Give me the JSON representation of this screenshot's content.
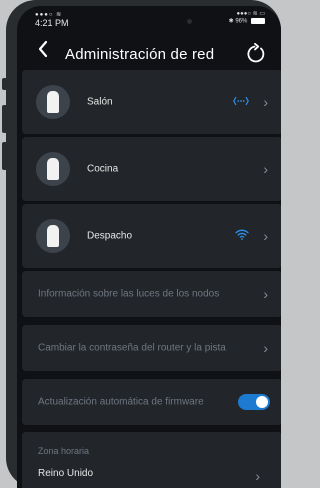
{
  "status_bar": {
    "time": "4:21 PM",
    "signal": "●●●○",
    "right_top": "●●●○",
    "battery": "96%"
  },
  "header": {
    "back_icon": "chevron-left-icon",
    "title": "Administración de red",
    "refresh_icon": "refresh-icon"
  },
  "nodes": [
    {
      "name": "Salón",
      "status_icon": "ethernet-dots-icon",
      "status_color": "#2f8fe8"
    },
    {
      "name": "Cocina",
      "status_icon": "",
      "status_color": ""
    },
    {
      "name": "Despacho",
      "status_icon": "wifi-icon",
      "status_color": "#2f8fe8"
    }
  ],
  "options": {
    "lights_info": "Información sobre las luces de los nodos",
    "change_password": "Cambiar la contraseña del router y la pista",
    "auto_update": "Actualización automática de firmware",
    "auto_update_enabled": true,
    "timezone_label": "Zona horaria",
    "timezone_value": "Reino Unido"
  },
  "colors": {
    "accent": "#1d7ad1",
    "background": "#0f1114",
    "card": "#22262b"
  }
}
